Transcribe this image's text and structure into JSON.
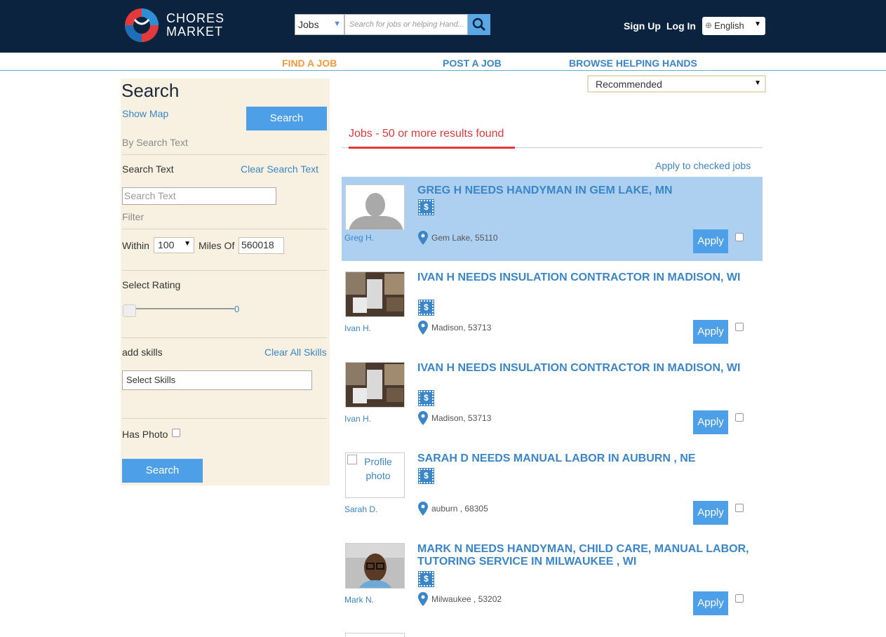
{
  "brand": {
    "line1": "CHORES",
    "line2": "MARKET"
  },
  "header": {
    "category": "Jobs",
    "search_placeholder": "Search for jobs or helping Hand...",
    "signup": "Sign Up",
    "login": "Log In",
    "language": "English"
  },
  "nav": {
    "find_job": "FIND A JOB",
    "post_job": "POST A JOB",
    "browse": "BROWSE HELPING HANDS"
  },
  "sidebar": {
    "title": "Search",
    "show_map": "Show Map",
    "search_button": "Search",
    "by_search_text": "By Search Text",
    "search_text_label": "Search Text",
    "clear_search_text": "Clear Search Text",
    "search_text_placeholder": "Search Text",
    "filter": "Filter",
    "within": "Within",
    "within_value": "100",
    "miles_of": "Miles Of",
    "zip": "560018",
    "select_rating": "Select Rating",
    "rating_value": "0",
    "add_skills": "add skills",
    "clear_all_skills": "Clear All Skills",
    "skills_placeholder": "Select Skills",
    "has_photo": "Has Photo",
    "search_button_bottom": "Search"
  },
  "main": {
    "sort": "Recommended",
    "results_tab": "Jobs - 50 or more results found",
    "apply_checked": "Apply to checked jobs",
    "apply_label": "Apply",
    "dollar": "$",
    "broken_photo_text": "Profile photo",
    "jobs": [
      {
        "title": "GREG H NEEDS HANDYMAN IN GEM LAKE, MN",
        "poster": "Greg H.",
        "location": "Gem Lake, 55110"
      },
      {
        "title": "IVAN H NEEDS INSULATION CONTRACTOR IN MADISON, WI",
        "poster": "Ivan H.",
        "location": "Madison, 53713"
      },
      {
        "title": "IVAN H NEEDS INSULATION CONTRACTOR IN MADISON, WI",
        "poster": "Ivan H.",
        "location": "Madison, 53713"
      },
      {
        "title": "SARAH D NEEDS MANUAL LABOR IN AUBURN , NE",
        "poster": "Sarah D.",
        "location": "auburn , 68305"
      },
      {
        "title": "MARK N NEEDS HANDYMAN, CHILD CARE, MANUAL LABOR, TUTORING SERVICE IN MILWAUKEE , WI",
        "poster": "Mark N.",
        "location": "Milwaukee , 53202"
      }
    ]
  },
  "colors": {
    "header_bg": "#0c2340",
    "accent_blue": "#3a86c8",
    "nav_active": "#f39a3c",
    "results_red": "#e03a3e",
    "sidebar_bg": "#f8f1e1",
    "highlight": "#add0f1"
  }
}
